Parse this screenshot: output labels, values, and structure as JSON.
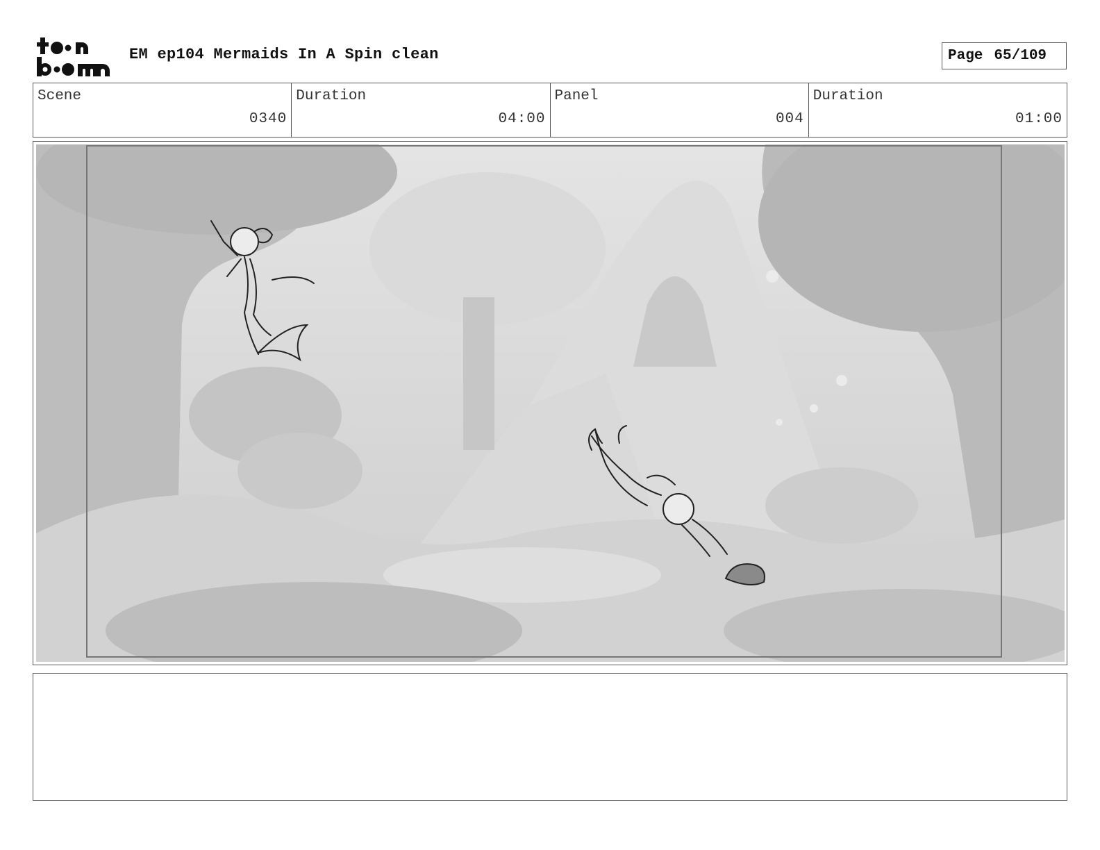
{
  "header": {
    "logo_text": "toon boom",
    "document_title": "EM ep104 Mermaids In A Spin clean",
    "page_label": "Page",
    "page_number": "65/109"
  },
  "info_row": [
    {
      "label": "Scene",
      "value": "0340"
    },
    {
      "label": "Duration",
      "value": "04:00"
    },
    {
      "label": "Panel",
      "value": "004"
    },
    {
      "label": "Duration",
      "value": "01:00"
    }
  ],
  "panel": {
    "image_description_icon": "storyboard-panel-image"
  },
  "notes": {
    "text": ""
  }
}
